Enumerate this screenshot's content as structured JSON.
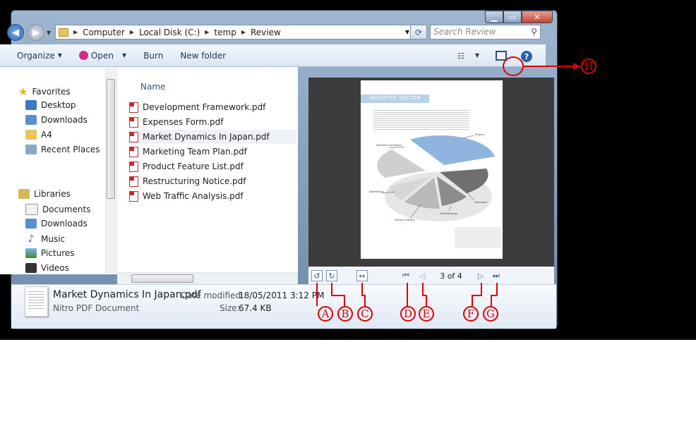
{
  "address": {
    "segments": [
      "Computer",
      "Local Disk (C:)",
      "temp",
      "Review"
    ]
  },
  "search": {
    "placeholder": "Search Review"
  },
  "toolbar": {
    "organize": "Organize",
    "open": "Open",
    "burn": "Burn",
    "new_folder": "New folder"
  },
  "nav": {
    "favorites": "Favorites",
    "favorites_items": [
      "Desktop",
      "Downloads",
      "A4",
      "Recent Places"
    ],
    "libraries": "Libraries",
    "libraries_items": [
      "Documents",
      "Downloads",
      "Music",
      "Pictures",
      "Videos"
    ]
  },
  "files": {
    "column": "Name",
    "items": [
      "Development Framework.pdf",
      "Expenses Form.pdf",
      "Market Dynamics In Japan.pdf",
      "Marketing Team Plan.pdf",
      "Product Feature List.pdf",
      "Restructuring Notice.pdf",
      "Web Traffic Analysis.pdf"
    ],
    "selected_index": 2
  },
  "preview": {
    "banner": "INDUSTRY SECTOR",
    "pie_labels": [
      "Finance",
      "Telecommunications",
      "Advertising",
      "Primary Industry",
      "Film/Television",
      "Education"
    ],
    "page_indicator": "3 of 4"
  },
  "details": {
    "name": "Market Dynamics In Japan.pdf",
    "type": "Nitro PDF Document",
    "date_label": "Date modified:",
    "date_value": "18/05/2011 3:12 PM",
    "size_label": "Size:",
    "size_value": "67.4 KB"
  },
  "callouts": [
    "A",
    "B",
    "C",
    "D",
    "E",
    "F",
    "G",
    "H"
  ],
  "colors": {
    "callout": "#e00000",
    "pie_highlight": "#8fb4e0"
  }
}
